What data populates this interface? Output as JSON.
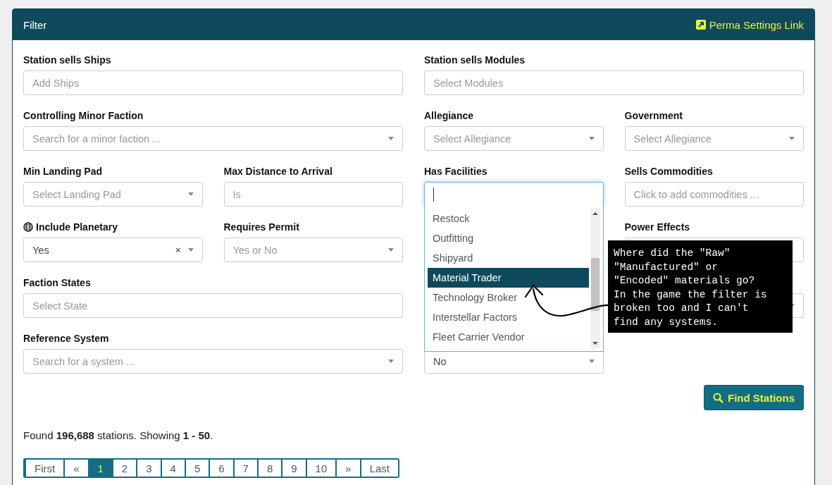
{
  "panel": {
    "title": "Filter",
    "link": "Perma Settings Link"
  },
  "rows": [
    {
      "fields": [
        {
          "kind": "text",
          "wide": true,
          "label": "Station sells Ships",
          "placeholder": "Add Ships"
        },
        {
          "kind": "text",
          "wide": true,
          "label": "Station sells Modules",
          "placeholder": "Select Modules"
        }
      ]
    },
    {
      "fields": [
        {
          "kind": "select",
          "wide": true,
          "label": "Controlling Minor Faction",
          "placeholder": "Search for a minor faction ..."
        },
        {
          "kind": "select",
          "wide": false,
          "label": "Allegiance",
          "placeholder": "Select Allegiance"
        },
        {
          "kind": "select",
          "wide": false,
          "label": "Government",
          "placeholder": "Select Allegiance"
        }
      ]
    },
    {
      "fields": [
        {
          "kind": "select",
          "wide": false,
          "label": "Min Landing Pad",
          "placeholder": "Select Landing Pad"
        },
        {
          "kind": "text",
          "wide": false,
          "label": "Max Distance to Arrival",
          "placeholder": "Is"
        },
        {
          "kind": "dropdown",
          "wide": false,
          "label": "Has Facilities",
          "options": [
            {
              "label": "Restock",
              "selected": false
            },
            {
              "label": "Outfitting",
              "selected": false
            },
            {
              "label": "Shipyard",
              "selected": false
            },
            {
              "label": "Material Trader",
              "selected": true
            },
            {
              "label": "Technology Broker",
              "selected": false
            },
            {
              "label": "Interstellar Factors",
              "selected": false
            },
            {
              "label": "Fleet Carrier Vendor",
              "selected": false
            }
          ]
        },
        {
          "kind": "text",
          "wide": false,
          "label": "Sells Commodities",
          "placeholder": "Click to add commodities ..."
        }
      ]
    },
    {
      "fields": [
        {
          "kind": "select",
          "wide": false,
          "label": "Include Planetary",
          "globe": true,
          "value": "Yes",
          "clear": "×"
        },
        {
          "kind": "select",
          "wide": false,
          "label": "Requires Permit",
          "placeholder": "Yes or No"
        },
        {
          "kind": "empty"
        },
        {
          "kind": "text",
          "wide": false,
          "label": "Power Effects"
        }
      ]
    },
    {
      "fields": [
        {
          "kind": "text",
          "wide": true,
          "label": "Faction States",
          "placeholder": "Select State"
        },
        {
          "kind": "empty"
        },
        {
          "kind": "select",
          "wide": false
        }
      ]
    },
    {
      "fields": [
        {
          "kind": "select",
          "wide": true,
          "label": "Reference System",
          "placeholder": "Search for a system ..."
        },
        {
          "kind": "select",
          "wide": false,
          "value": "No"
        }
      ]
    }
  ],
  "find_button": "Find Stations",
  "summary": "Found **196,688** stations. Showing **1 - 50**.",
  "pagination": [
    {
      "label": "First",
      "selected": false
    },
    {
      "label": "«",
      "selected": false
    },
    {
      "label": "1",
      "selected": true
    },
    {
      "label": "2",
      "selected": false
    },
    {
      "label": "3",
      "selected": false
    },
    {
      "label": "4",
      "selected": false
    },
    {
      "label": "5",
      "selected": false
    },
    {
      "label": "6",
      "selected": false
    },
    {
      "label": "7",
      "selected": false
    },
    {
      "label": "8",
      "selected": false
    },
    {
      "label": "9",
      "selected": false
    },
    {
      "label": "10",
      "selected": false
    },
    {
      "label": "»",
      "selected": false
    },
    {
      "label": "Last",
      "selected": false
    }
  ],
  "annotation": "Where did the \"Raw\"\n\"Manufactured\" or\n\"Encoded\" materials go?\nIn the game the filter is\nbroken too and I can't\nfind any systems."
}
